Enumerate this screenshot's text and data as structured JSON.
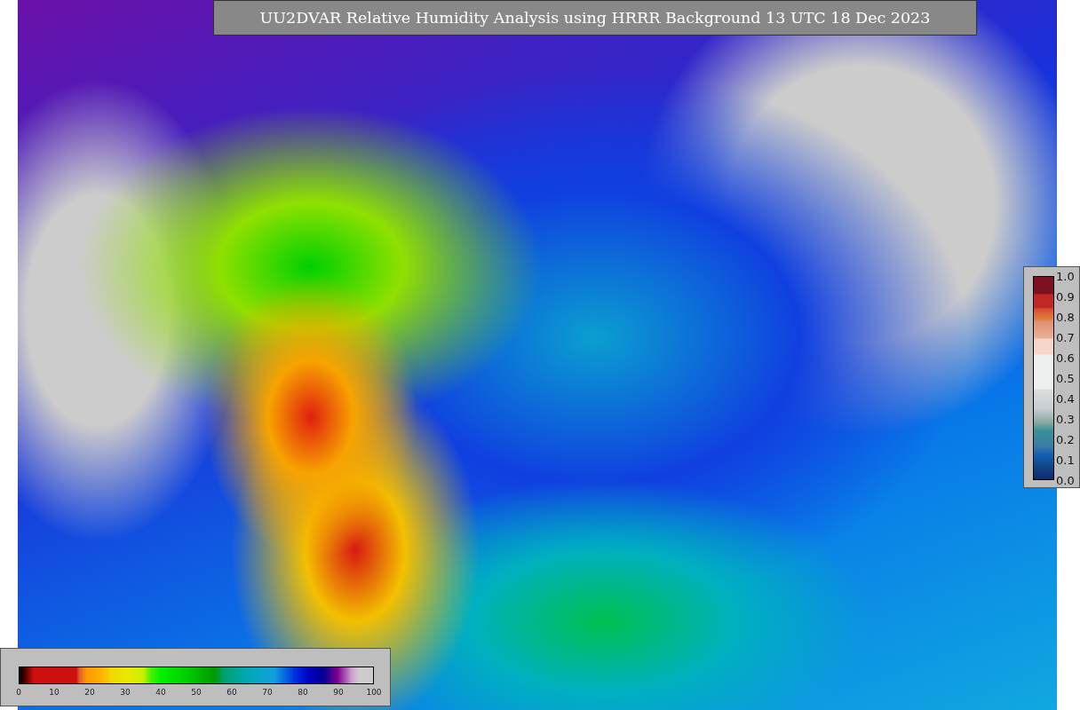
{
  "title": "UU2DVAR Relative Humidity Analysis using HRRR Background 13 UTC 18 Dec 2023",
  "bottom_colorbar": {
    "tick_labels": [
      "0",
      "10",
      "20",
      "30",
      "40",
      "50",
      "60",
      "70",
      "80",
      "90",
      "100"
    ]
  },
  "right_colorbar": {
    "tick_labels": [
      "1.0",
      "0.9",
      "0.8",
      "0.7",
      "0.6",
      "0.5",
      "0.4",
      "0.3",
      "0.2",
      "0.1",
      "0.0"
    ]
  }
}
